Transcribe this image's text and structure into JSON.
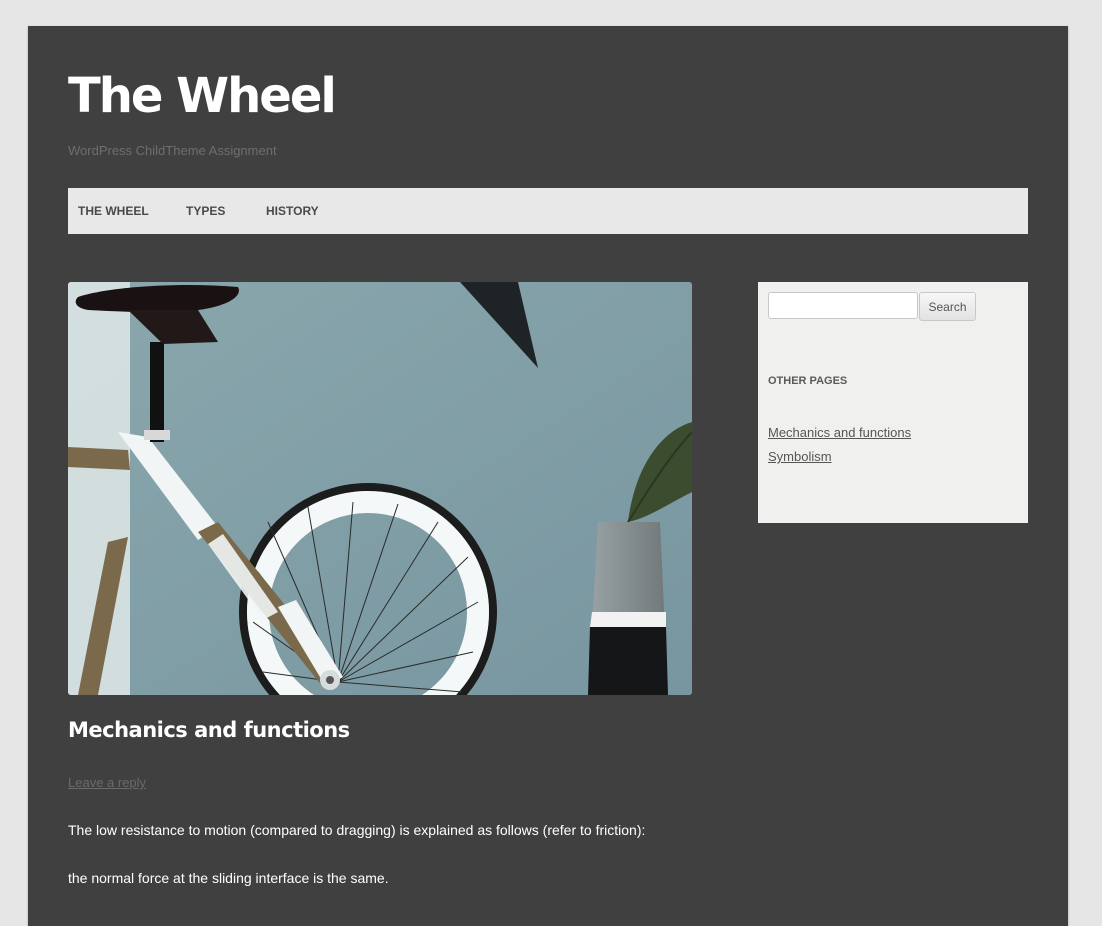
{
  "site": {
    "title": "The Wheel",
    "description": "WordPress ChildTheme Assignment"
  },
  "nav": {
    "items": [
      {
        "label": "THE WHEEL"
      },
      {
        "label": "TYPES"
      },
      {
        "label": "HISTORY"
      }
    ]
  },
  "post": {
    "image_alt": "bicycle-wheel-photo",
    "title": "Mechanics and functions",
    "reply_link": "Leave a reply",
    "paragraphs": [
      "The low resistance to motion (compared to dragging) is explained as follows (refer to friction):",
      "the normal force at the sliding interface is the same."
    ]
  },
  "sidebar": {
    "search": {
      "value": "",
      "button_label": "Search"
    },
    "widget_title": "OTHER PAGES",
    "links": [
      {
        "label": "Mechanics and functions"
      },
      {
        "label": "Symbolism"
      }
    ]
  },
  "colors": {
    "page_background": "#e6e6e6",
    "content_background": "#404040",
    "nav_background": "#e8e8e8",
    "sidebar_background": "#f0f0ee",
    "title_text": "#ffffff"
  }
}
